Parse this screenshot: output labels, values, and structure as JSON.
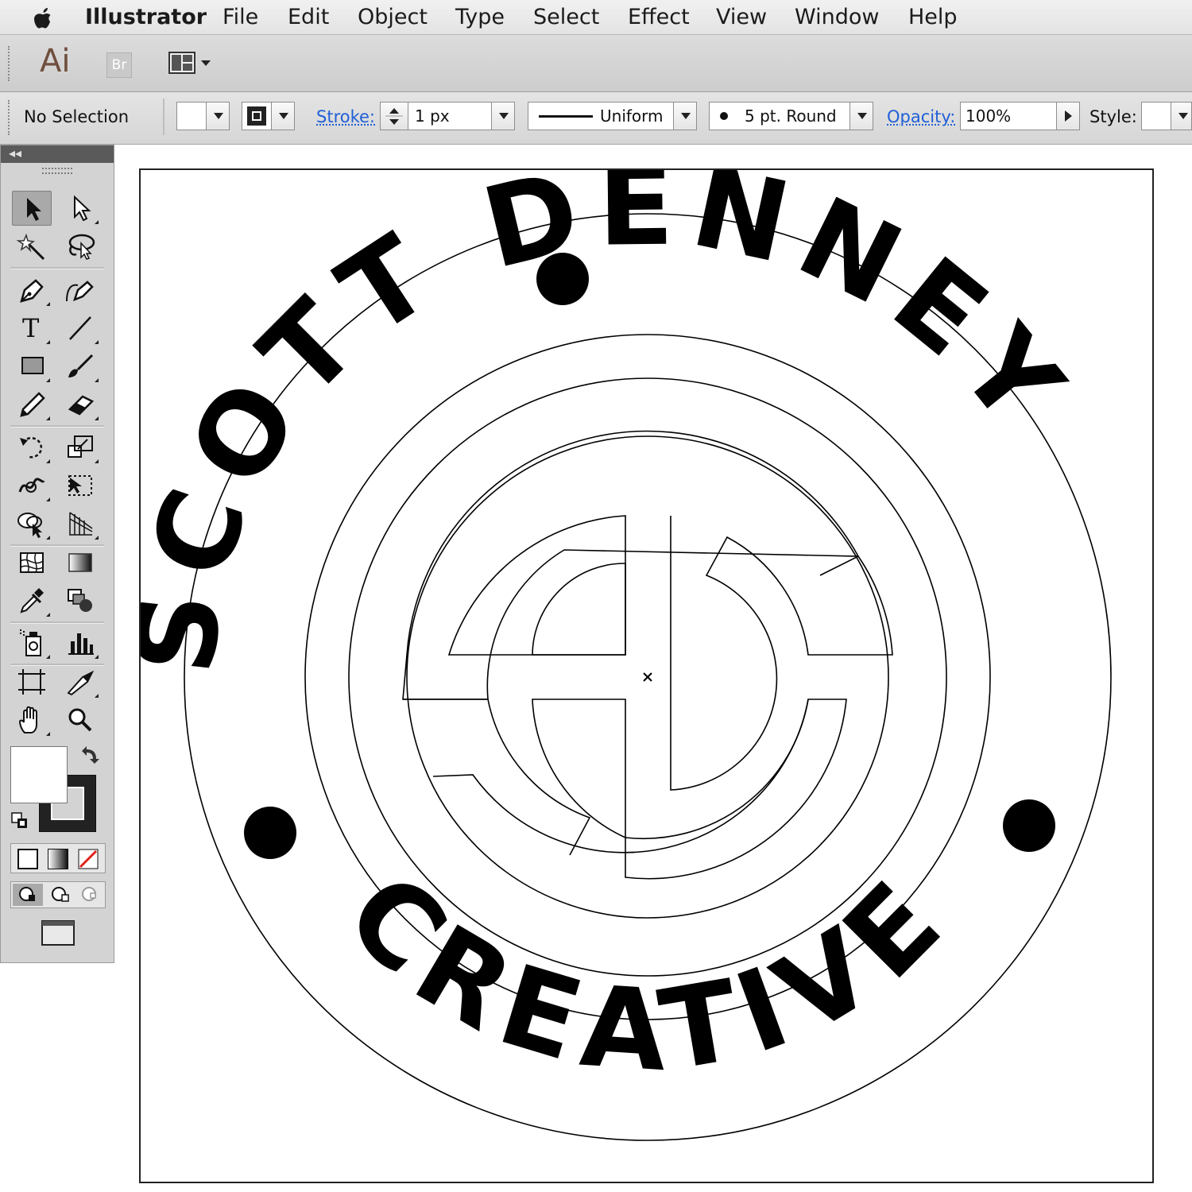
{
  "menubar": {
    "apple": "",
    "app_name": "Illustrator",
    "items": [
      "File",
      "Edit",
      "Object",
      "Type",
      "Select",
      "Effect",
      "View",
      "Window",
      "Help"
    ]
  },
  "appbar": {
    "ai_logo": "Ai",
    "br_logo": "Br"
  },
  "controlbar": {
    "selection": "No Selection",
    "stroke_label": "Stroke:",
    "stroke_weight": "1 px",
    "profile": "Uniform",
    "brush": "5 pt. Round",
    "opacity_label": "Opacity:",
    "opacity_value": "100%",
    "style_label": "Style:"
  },
  "tools": [
    "selection-tool",
    "direct-selection-tool",
    "magic-wand-tool",
    "lasso-tool",
    "pen-tool",
    "curvature-tool",
    "type-tool",
    "line-segment-tool",
    "rectangle-tool",
    "paintbrush-tool",
    "pencil-tool",
    "eraser-tool",
    "rotate-tool",
    "scale-tool",
    "warp-tool",
    "free-transform-tool",
    "shape-builder-tool",
    "perspective-grid-tool",
    "mesh-tool",
    "gradient-tool",
    "eyedropper-tool",
    "blend-tool",
    "symbol-sprayer-tool",
    "column-graph-tool",
    "artboard-tool",
    "slice-tool",
    "hand-tool",
    "zoom-tool"
  ],
  "artwork": {
    "top_text_left": "SCOTT",
    "top_text_right": "DENNEY",
    "bottom_text": "CREATIVE"
  },
  "colors": {
    "menubar_bg": "#e8e8e8",
    "panel_bg": "#d3d3d3",
    "link_blue": "#1f5fd6",
    "artwork_ink": "#000000"
  }
}
